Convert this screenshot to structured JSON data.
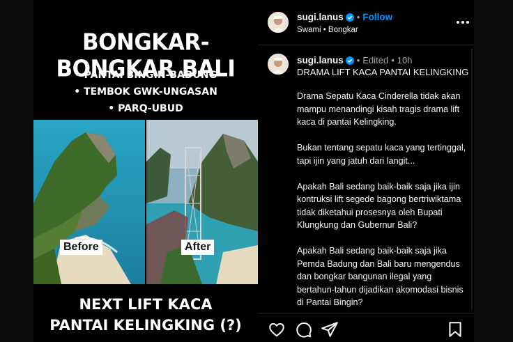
{
  "image": {
    "headline": "BONGKAR-BONGKAR BALI",
    "bullets": [
      "• PANTAI BINGIN-BADUNG",
      "• TEMBOK GWK-UNGASAN",
      "• PARQ-UBUD"
    ],
    "before_label": "Before",
    "after_label": "After",
    "bottom_title_line1": "NEXT LIFT KACA",
    "bottom_title_line2": "PANTAI KELINGKING (?)"
  },
  "header": {
    "username": "sugi.lanus",
    "separator": "•",
    "follow_label": "Follow",
    "subtitle": "Swami • Bongkar",
    "more_icon": "more-horizontal-icon"
  },
  "caption": {
    "username": "sugi.lanus",
    "separator": "•",
    "edited": "Edited",
    "time": "10h",
    "title": "DRAMA LIFT KACA PANTAI KELINGKING",
    "paragraphs": [
      "Drama Sepatu Kaca Cinderella tidak akan mampu menandingi kisah tragis drama lift kaca di pantai Kelingking.",
      "Bukan tentang sepatu kaca yang tertinggal, tapi ijin yang jatuh dari langit...",
      "Apakah Bali sedang baik-baik saja jika ijin kontruksi lift segede bagong bertriwiktama tidak diketahui prosesnya oleh Bupati Klungkung dan Gubernur Bali?",
      "Apakah Bali sedang baik-baik saja jika Pemda Badung dan Bali baru mengendus dan bongkar bangunan ilegal yang bertahun-tahun dijadikan akomodasi bisnis di Pantai Bingin?"
    ]
  },
  "actions": {
    "like_icon": "heart-icon",
    "comment_icon": "comment-icon",
    "share_icon": "share-icon",
    "save_icon": "bookmark-icon"
  },
  "colors": {
    "background": "#000000",
    "accent": "#0095f6",
    "muted": "#a8a8a8",
    "divider": "#262626"
  }
}
